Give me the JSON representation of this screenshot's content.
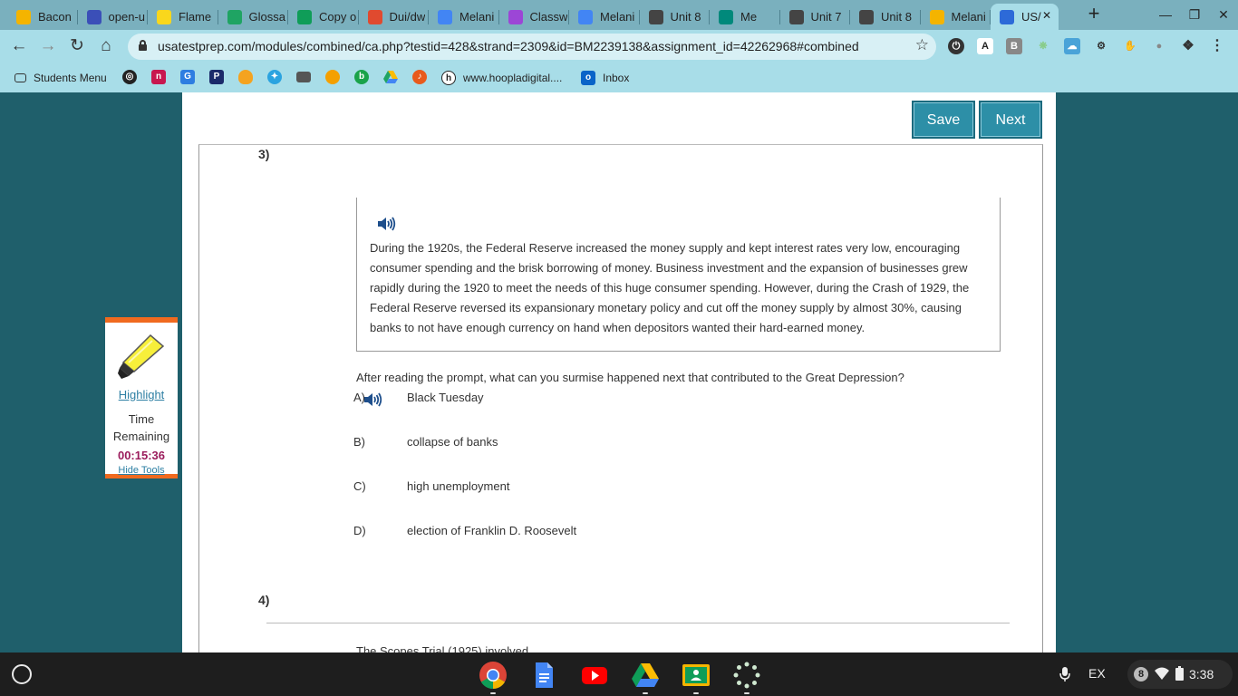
{
  "browser": {
    "tabs": [
      {
        "title": "Bacon",
        "icon": "slides-icon",
        "color": "#f4b400"
      },
      {
        "title": "open-u",
        "icon": "kami-icon",
        "color": "#3b4fb8"
      },
      {
        "title": "Flame",
        "icon": "bulb-icon",
        "color": "#f9d71c"
      },
      {
        "title": "Glossa",
        "icon": "drive-icon",
        "color": "#1fa463"
      },
      {
        "title": "Copy o",
        "icon": "sheets-icon",
        "color": "#0f9d58"
      },
      {
        "title": "Dui/dw",
        "icon": "flag-icon",
        "color": "#e04a2f"
      },
      {
        "title": "Melani",
        "icon": "docs-icon",
        "color": "#4285f4"
      },
      {
        "title": "Classw",
        "icon": "classroom-icon",
        "color": "#9c46d6"
      },
      {
        "title": "Melani",
        "icon": "docs-icon",
        "color": "#4285f4"
      },
      {
        "title": "Unit 8",
        "icon": "assignment-icon",
        "color": "#444444"
      },
      {
        "title": "Me",
        "icon": "meet-icon",
        "color": "#00897b"
      },
      {
        "title": "Unit 7",
        "icon": "assignment-icon",
        "color": "#444444"
      },
      {
        "title": "Unit 8",
        "icon": "assignment-icon",
        "color": "#444444"
      },
      {
        "title": "Melani",
        "icon": "slides-icon",
        "color": "#f4b400"
      },
      {
        "title": "US/",
        "icon": "cursor-icon",
        "color": "#2d6ad8"
      }
    ],
    "url": "usatestprep.com/modules/combined/ca.php?testid=428&strand=2309&id=BM2239138&assignment_id=42262968#combined",
    "bookmarks": [
      {
        "label": "Students Menu",
        "icon": "folder-icon"
      },
      {
        "label": "www.hoopladigital....",
        "icon": "hoopla-icon"
      },
      {
        "label": "Inbox",
        "icon": "outlook-icon"
      }
    ]
  },
  "toolbar": {
    "save_label": "Save",
    "next_label": "Next"
  },
  "question3": {
    "number": "3)",
    "passage": "During the 1920s, the Federal Reserve increased the money supply and kept interest rates very low, encouraging consumer spending and the brisk borrowing of money. Business investment and the expansion of businesses grew rapidly during the 1920 to meet the needs of this huge consumer spending. However, during the Crash of 1929, the Federal Reserve reversed its expansionary monetary policy and cut off the money supply by almost 30%, causing banks to not have enough currency on hand when depositors wanted their hard-earned money.",
    "prompt": "After reading the prompt, what can you surmise happened next that contributed to the Great Depression?",
    "choices": [
      {
        "letter": "A)",
        "text": "Black Tuesday"
      },
      {
        "letter": "B)",
        "text": "collapse of banks"
      },
      {
        "letter": "C)",
        "text": "high unemployment"
      },
      {
        "letter": "D)",
        "text": "election of Franklin D. Roosevelt"
      }
    ]
  },
  "question4": {
    "number": "4)",
    "prompt": "The Scopes Trial (1925) involved"
  },
  "tools": {
    "highlight_label": "Highlight",
    "time_label_1": "Time",
    "time_label_2": "Remaining",
    "timer": "00:15:36",
    "hide_label": "Hide Tools"
  },
  "shelf": {
    "ime": "EX",
    "notifications": "8",
    "clock": "3:38"
  }
}
